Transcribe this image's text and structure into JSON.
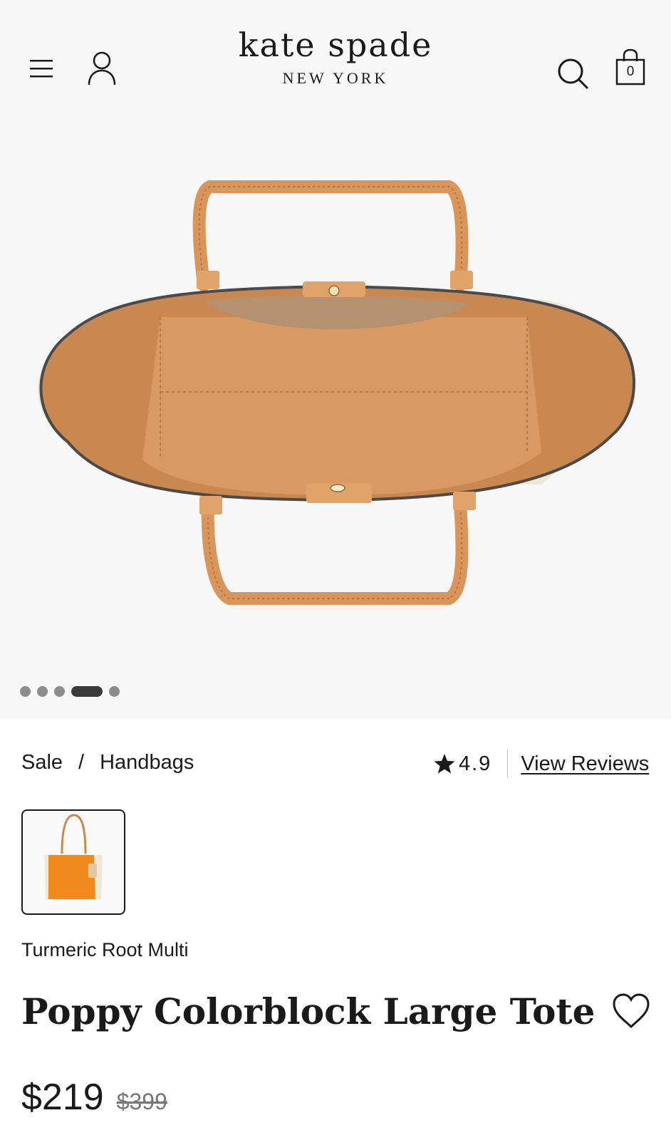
{
  "header": {
    "logo_main": "kate spade",
    "logo_sub": "NEW YORK",
    "bag_count": "0",
    "icons": [
      "menu-icon",
      "account-icon",
      "search-icon",
      "bag-icon"
    ]
  },
  "gallery": {
    "image_alt": "Poppy Colorblock Large Tote interior view",
    "slide_count": 5,
    "active_slide": 4
  },
  "breadcrumb": {
    "items": [
      "Sale",
      "Handbags"
    ],
    "separator": "/"
  },
  "rating": {
    "value": "4.9",
    "reviews_label": "View Reviews"
  },
  "product": {
    "color_name": "Turmeric Root Multi",
    "title": "Poppy Colorblock Large Tote",
    "price_sale": "$219",
    "price_original": "$399"
  },
  "colors": {
    "leather": "#d9955a",
    "interior": "#c98850",
    "swatch_orange": "#f08a1c"
  }
}
